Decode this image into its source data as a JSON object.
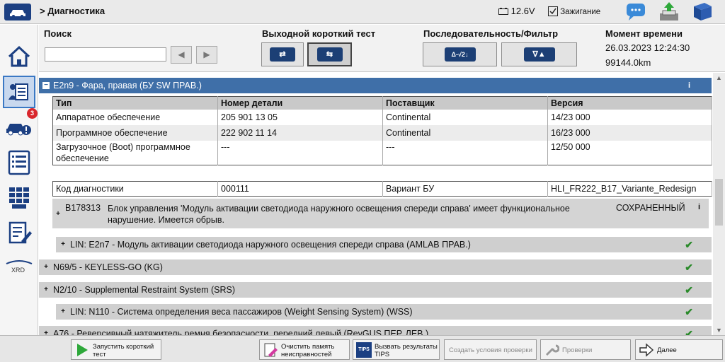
{
  "header": {
    "breadcrumb": "> Диагностика",
    "voltage": "12.6V",
    "ignition_label": "Зажигание"
  },
  "sidebar": {
    "badge_count": "3",
    "xrd_label": "XRD"
  },
  "panel": {
    "search_label": "Поиск",
    "search_value": "",
    "short_test_label": "Выходной короткий тест",
    "sequence_filter_label": "Последовательность/Фильтр",
    "filter_icon_1": "Δ-√2↓",
    "filter_icon_2": "∇▲",
    "time_label": "Момент времени",
    "date_time": "26.03.2023 12:24:30",
    "mileage": "99144.0km"
  },
  "content": {
    "ecu_title": "E2n9 - Фара, правая (БУ SW ПРАВ.)",
    "info_mark": "i",
    "table": {
      "headers": [
        "Тип",
        "Номер детали",
        "Поставщик",
        "Версия"
      ],
      "rows": [
        [
          "Аппаратное обеспечение",
          "205 901 13 05",
          "Continental",
          "14/23 000"
        ],
        [
          "Программное обеспечение",
          "222 902 11 14",
          "Continental",
          "16/23 000"
        ],
        [
          "Загрузочное (Boot) программное обеспечение",
          "---",
          "---",
          "12/50 000"
        ]
      ]
    },
    "diag": {
      "label": "Код диагностики",
      "code": "000111",
      "variant_label": "Вариант БУ",
      "variant_value": "HLI_FR222_B17_Variante_Redesign"
    },
    "fault": {
      "code": "B178313",
      "text": "Блок управления 'Модуль активации светодиода наружного освещения спереди справа' имеет функциональное нарушение. Имеется обрыв.",
      "status": "СОХРАНЕННЫЙ"
    },
    "items": [
      {
        "label": "LIN: E2n7 - Модуль активации светодиода наружного освещения спереди справа (AMLAB ПРАВ.)",
        "sub": true
      },
      {
        "label": "N69/5 - KEYLESS-GO (KG)",
        "sub": false
      },
      {
        "label": "N2/10 - Supplemental Restraint System (SRS)",
        "sub": false
      },
      {
        "label": "LIN: N110 - Система определения веса пассажиров (Weight Sensing System) (WSS)",
        "sub": true
      },
      {
        "label": "A76 - Реверсивный натяжитель ремня безопасности, передний левый (RevGUS ПЕР. ЛЕВ.)",
        "sub": false
      }
    ],
    "check_mark": "✔",
    "expand_sign": "+",
    "collapse_sign": "−"
  },
  "footer": {
    "start_short_test": "Запустить короткий тест",
    "clear_fault_memory": "Очистить память неисправностей",
    "call_tips": "Вызвать результаты TIPS",
    "tips_icon": "TIPS",
    "create_conditions": "Создать условия проверки",
    "checks": "Проверки",
    "next": "Далее"
  },
  "colors": {
    "brand": "#1b3f82",
    "selected_row": "#3f6fa8",
    "ok_green": "#2a8a2a",
    "badge_red": "#d9262c"
  }
}
